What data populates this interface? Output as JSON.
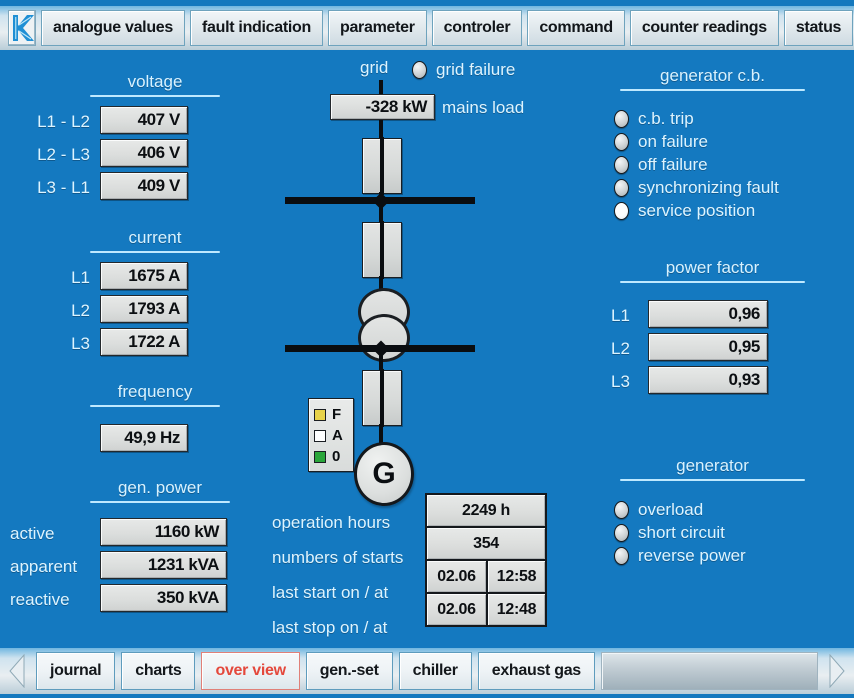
{
  "app": {
    "logo_text": "K",
    "background_color": "#1479c0",
    "accent_text_color": "#ddf4ff",
    "active_tab_color": "#e4483c"
  },
  "top_tabs": [
    {
      "label": "analogue values"
    },
    {
      "label": "fault indication"
    },
    {
      "label": "parameter"
    },
    {
      "label": "controler"
    },
    {
      "label": "command"
    },
    {
      "label": "counter readings"
    },
    {
      "label": "status"
    }
  ],
  "bottom_tabs": [
    {
      "label": "journal",
      "active": false
    },
    {
      "label": "charts",
      "active": false
    },
    {
      "label": "over view",
      "active": true
    },
    {
      "label": "gen.-set",
      "active": false
    },
    {
      "label": "chiller",
      "active": false
    },
    {
      "label": "exhaust gas",
      "active": false
    }
  ],
  "voltage": {
    "title": "voltage",
    "rows": [
      {
        "label": "L1 - L2",
        "value": "407 V"
      },
      {
        "label": "L2 - L3",
        "value": "406 V"
      },
      {
        "label": "L3 - L1",
        "value": "409 V"
      }
    ]
  },
  "current": {
    "title": "current",
    "rows": [
      {
        "label": "L1",
        "value": "1675 A"
      },
      {
        "label": "L2",
        "value": "1793 A"
      },
      {
        "label": "L3",
        "value": "1722 A"
      }
    ]
  },
  "frequency": {
    "title": "frequency",
    "value": "49,9 Hz"
  },
  "gen_power": {
    "title": "gen. power",
    "rows": [
      {
        "label": "active",
        "value": "1160 kW"
      },
      {
        "label": "apparent",
        "value": "1231 kVA"
      },
      {
        "label": "reactive",
        "value": "350 kVA"
      }
    ]
  },
  "generator_cb": {
    "title": "generator c.b.",
    "leds": [
      {
        "label": "c.b. trip",
        "on": false
      },
      {
        "label": "on failure",
        "on": false
      },
      {
        "label": "off failure",
        "on": false
      },
      {
        "label": "synchronizing fault",
        "on": false
      },
      {
        "label": "service position",
        "on": true
      }
    ]
  },
  "power_factor": {
    "title": "power factor",
    "rows": [
      {
        "label": "L1",
        "value": "0,96"
      },
      {
        "label": "L2",
        "value": "0,95"
      },
      {
        "label": "L3",
        "value": "0,93"
      }
    ]
  },
  "generator": {
    "title": "generator",
    "leds": [
      {
        "label": "overload",
        "on": false
      },
      {
        "label": "short circuit",
        "on": false
      },
      {
        "label": "reverse power",
        "on": false
      }
    ]
  },
  "diagram": {
    "grid_label": "grid",
    "grid_failure_label": "grid failure",
    "grid_failure_on": false,
    "mains_load_value": "-328 kW",
    "mains_load_label": "mains load",
    "generator_symbol": "G",
    "mode_legend": [
      {
        "symbol": "F",
        "color": "#e8d34a"
      },
      {
        "symbol": "A",
        "color": "#ffffff"
      },
      {
        "symbol": "0",
        "color": "#2aa63a"
      }
    ]
  },
  "counters": {
    "rows": [
      {
        "label": "operation hours",
        "cells": [
          "2249 h"
        ]
      },
      {
        "label": "numbers of starts",
        "cells": [
          "354"
        ]
      },
      {
        "label": "last start on / at",
        "cells": [
          "02.06",
          "12:58"
        ]
      },
      {
        "label": "last stop on / at",
        "cells": [
          "02.06",
          "12:48"
        ]
      }
    ]
  }
}
